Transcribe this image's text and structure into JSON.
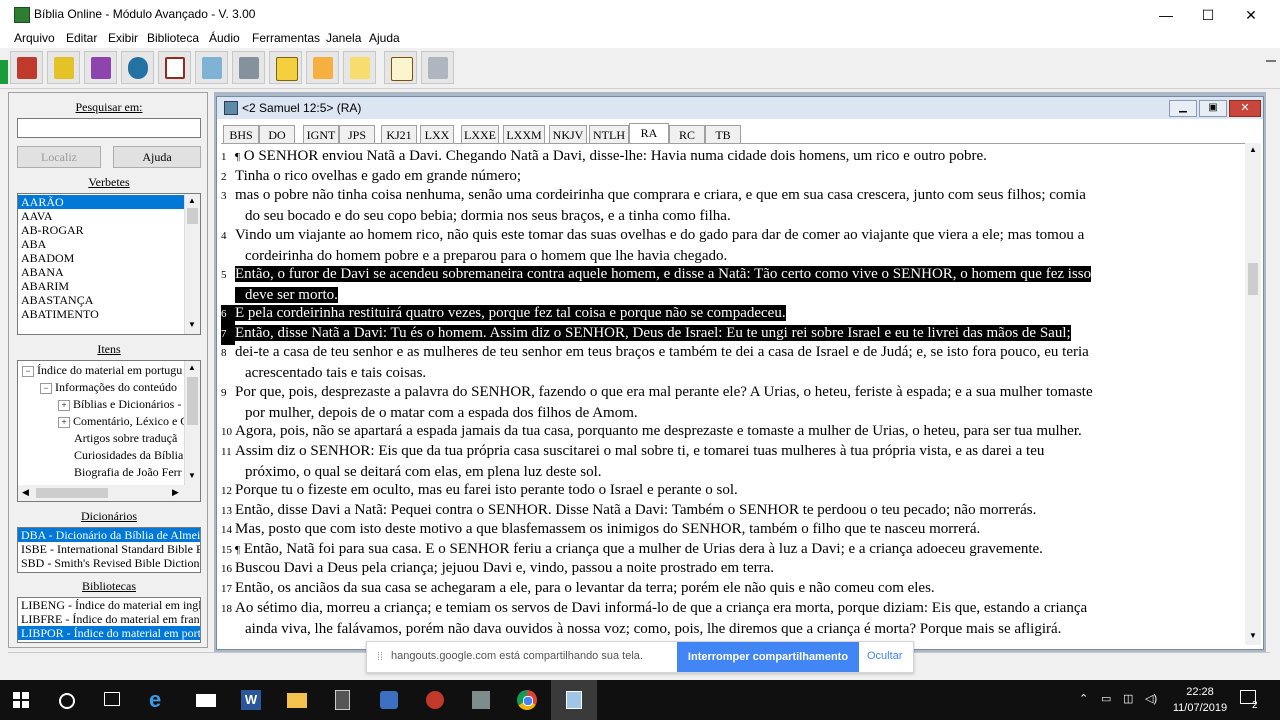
{
  "window": {
    "title": "Bíblia Online - Módulo Avançado - V. 3.00",
    "minimize": "—",
    "maximize": "☐",
    "close": "✕"
  },
  "menu": [
    "Arquivo",
    "Editar",
    "Exibir",
    "Biblioteca",
    "Áudio",
    "Ferramentas",
    "Janela",
    "Ajuda"
  ],
  "toolbar_icons": [
    "bible-icon",
    "notes-icon",
    "books-icon",
    "globe-icon",
    "open-book-icon",
    "computer-icon",
    "tools-icon",
    "clipboard-icon",
    "folder-icon",
    "edit-icon",
    "document-icon",
    "printer-icon"
  ],
  "left": {
    "search_label": "Pesquisar em:",
    "search_value": "",
    "locate_btn": "Localiz",
    "help_btn": "Ajuda",
    "verbetes_label": "Verbetes",
    "verbetes": [
      "AARÃO",
      "AAVA",
      "AB-ROGAR",
      "ABA",
      "ABADOM",
      "ABANA",
      "ABARIM",
      "ABASTANÇA",
      "ABATIMENTO"
    ],
    "itens_label": "Itens",
    "tree": [
      {
        "exp": "−",
        "text": "Índice do material em portugu"
      },
      {
        "exp": "−",
        "text": "Informações do conteúdo"
      },
      {
        "exp": "+",
        "text": "Bíblias e Dicionários - "
      },
      {
        "exp": "+",
        "text": "Comentário, Léxico e C"
      },
      {
        "exp": "",
        "text": "Artigos sobre traduçã"
      },
      {
        "exp": "",
        "text": "Curiosidades da Bíblia"
      },
      {
        "exp": "",
        "text": "Biografia de João Ferr"
      }
    ],
    "dicionarios_label": "Dicionários",
    "dicionarios": [
      "DBA - Dicionário da Bíblia de Almei",
      "ISBE - International Standard Bible E",
      "SBD - Smith's Revised Bible Diction"
    ],
    "bibliotecas_label": "Bibliotecas",
    "bibliotecas": [
      "LIBENG - Índice do material em inglê",
      "LIBFRE - Índice do material em franc",
      "LIBPOR - Índice do material em port"
    ]
  },
  "child": {
    "title": "<2 Samuel 12:5> (RA)",
    "tabs": [
      "BHS",
      "DO",
      "IGNT",
      "JPS",
      "KJ21",
      "LXX",
      "LXXE",
      "LXXM",
      "NKJV",
      "NTLH",
      "RA",
      "RC",
      "TB"
    ],
    "active_tab": "RA",
    "verses": [
      {
        "n": "1",
        "p": "¶",
        "text": "O SENHOR enviou Natã a Davi. Chegando Natã a Davi, disse-lhe: Havia numa cidade dois homens, um rico e outro pobre.",
        "hl": false
      },
      {
        "n": "2",
        "p": "",
        "text": "Tinha o rico ovelhas e gado em grande número;",
        "hl": false
      },
      {
        "n": "3",
        "p": "",
        "text": "mas o pobre não tinha coisa nenhuma, senão uma cordeirinha que comprara e criara, e que em sua casa crescera, junto com seus filhos; comia",
        "cont": "do seu bocado e do seu copo bebia; dormia nos seus braços, e a tinha como filha.",
        "hl": false
      },
      {
        "n": "4",
        "p": "",
        "text": "Vindo um viajante ao homem rico, não quis este tomar das suas ovelhas e do gado para dar de comer ao viajante que viera a ele; mas tomou a",
        "cont": "cordeirinha do homem pobre e a preparou para o homem que lhe havia chegado.",
        "hl": false
      },
      {
        "n": "5",
        "p": "",
        "text": "Então, o furor de Davi se acendeu sobremaneira contra aquele homem, e disse a Natã: Tão certo como vive o SENHOR, o homem que fez isso",
        "cont": "deve ser morto.",
        "hl": true
      },
      {
        "n": "6",
        "p": "",
        "text": "E pela cordeirinha restituirá quatro vezes, porque fez tal coisa e porque não se compadeceu.",
        "hl": true
      },
      {
        "n": "7",
        "p": "",
        "text": "Então, disse Natã a Davi: Tu és o homem. Assim diz o SENHOR, Deus de Israel: Eu te ungi rei sobre Israel e eu te livrei das mãos de Saul;",
        "hl": true
      },
      {
        "n": "8",
        "p": "",
        "text": "dei-te a casa de teu senhor e as mulheres de teu senhor em teus braços e também te dei a casa de Israel e de Judá; e, se isto fora pouco, eu teria",
        "cont": "acrescentado tais e tais coisas.",
        "hl": false
      },
      {
        "n": "9",
        "p": "",
        "text": "Por que, pois, desprezaste a palavra do SENHOR, fazendo o que era mal perante ele? A Urias, o heteu, feriste à espada; e a sua mulher tomaste",
        "cont": "por mulher, depois de o matar com a espada dos filhos de Amom.",
        "hl": false
      },
      {
        "n": "10",
        "p": "",
        "text": "Agora, pois, não se apartará a espada jamais da tua casa, porquanto me desprezaste e tomaste a mulher de Urias, o heteu, para ser tua mulher.",
        "hl": false
      },
      {
        "n": "11",
        "p": "",
        "text": "Assim diz o SENHOR: Eis que da tua própria casa suscitarei o mal sobre ti, e tomarei tuas mulheres à tua própria vista, e as darei a teu",
        "cont": "próximo, o qual se deitará com elas, em plena luz deste sol.",
        "hl": false
      },
      {
        "n": "12",
        "p": "",
        "text": "Porque tu o fizeste em oculto, mas eu farei isto perante todo o Israel e perante o sol.",
        "hl": false
      },
      {
        "n": "13",
        "p": "",
        "text": "Então, disse Davi a Natã: Pequei contra o SENHOR. Disse Natã a Davi: Também o SENHOR te perdoou o teu pecado; não morrerás.",
        "hl": false
      },
      {
        "n": "14",
        "p": "",
        "text": "Mas, posto que com isto deste motivo a que blasfemassem os inimigos do SENHOR, também o filho que te nasceu morrerá.",
        "hl": false
      },
      {
        "n": "15",
        "p": "¶",
        "text": "Então, Natã foi para sua casa. E o SENHOR feriu a criança que a mulher de Urias dera à luz a Davi; e a criança adoeceu gravemente.",
        "hl": false
      },
      {
        "n": "16",
        "p": "",
        "text": "Buscou Davi a Deus pela criança; jejuou Davi e, vindo, passou a noite prostrado em terra.",
        "hl": false
      },
      {
        "n": "17",
        "p": "",
        "text": "Então, os anciãos da sua casa se achegaram a ele, para o levantar da terra; porém ele não quis e não comeu com eles.",
        "hl": false
      },
      {
        "n": "18",
        "p": "",
        "text": "Ao sétimo dia, morreu a criança; e temiam os servos de Davi informá-lo de que a criança era morta, porque diziam: Eis que, estando a criança",
        "cont": "ainda viva, lhe falávamos, porém não dava ouvidos à nossa voz; como, pois, lhe diremos que a criança é morta? Porque mais se afligirá.",
        "hl": false
      }
    ]
  },
  "share": {
    "message": "hangouts.google.com está compartilhando sua tela.",
    "stop": "Interromper compartilhamento",
    "hide": "Ocultar"
  },
  "taskbar": {
    "time": "22:28",
    "date": "11/07/2019",
    "notifications": "2"
  },
  "colors": {
    "selection": "#0078d7",
    "highlight": "#000000",
    "share_button": "#4285f4"
  }
}
